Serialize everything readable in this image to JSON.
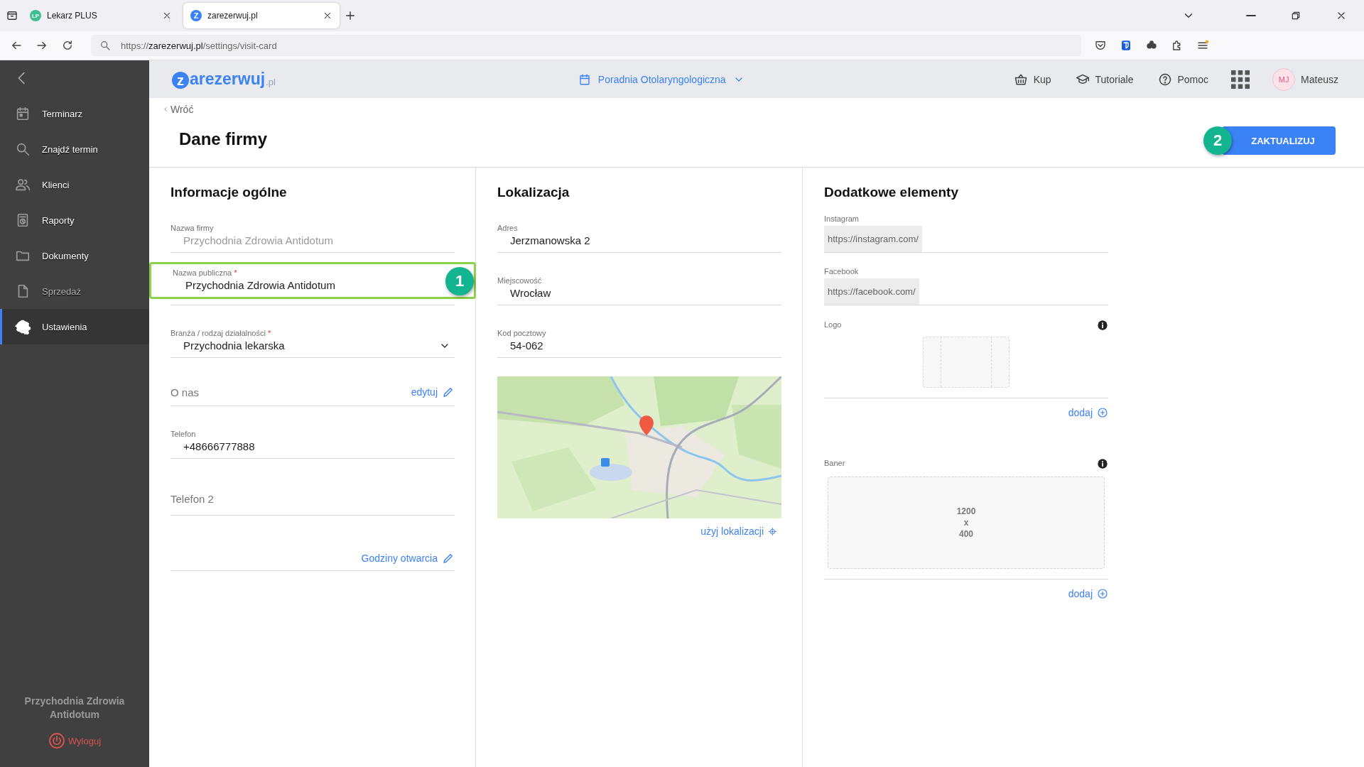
{
  "browser": {
    "tabs": [
      {
        "favicon": "LP",
        "title": "Lekarz PLUS",
        "selected": false
      },
      {
        "favicon": "Z",
        "title": "zarezerwuj.pl",
        "selected": true
      }
    ],
    "url": {
      "scheme": "https://",
      "host": "zarezerwuj.pl",
      "path": "/settings/visit-card"
    }
  },
  "sidebar": {
    "items": [
      {
        "label": "Terminarz",
        "selected": false,
        "disabled": false
      },
      {
        "label": "Znajdź termin",
        "selected": false,
        "disabled": false
      },
      {
        "label": "Klienci",
        "selected": false,
        "disabled": false
      },
      {
        "label": "Raporty",
        "selected": false,
        "disabled": false
      },
      {
        "label": "Dokumenty",
        "selected": false,
        "disabled": false
      },
      {
        "label": "Sprzedaż",
        "selected": false,
        "disabled": true
      },
      {
        "label": "Ustawienia",
        "selected": true,
        "disabled": false
      }
    ],
    "organization": "Przychodnia Zdrowia Antidotum",
    "logout": "Wyloguj"
  },
  "header": {
    "logo": {
      "mark": "z",
      "name": "arezerwuj",
      "suffix": ".pl"
    },
    "clinic": "Poradnia Otolaryngologiczna",
    "nav": [
      {
        "label": "Kup"
      },
      {
        "label": "Tutoriale"
      },
      {
        "label": "Pomoc"
      }
    ],
    "user": {
      "initials": "MJ",
      "name": "Mateusz"
    }
  },
  "page": {
    "back": "Wróć",
    "title": "Dane firmy",
    "action": {
      "label": "ZAKTUALIZUJ",
      "badge": "2"
    }
  },
  "sections": [
    {
      "title": "Informacje ogólne",
      "fields": [
        {
          "kind": "text",
          "label": "Nazwa firmy",
          "value": "Przychodnia Zdrowia Antidotum",
          "disabled": true
        },
        {
          "kind": "text",
          "label": "Nazwa publiczna",
          "required_mark": "*",
          "value": "Przychodnia Zdrowia Antidotum",
          "disabled": false,
          "highlighted": true,
          "badge": "1"
        },
        {
          "kind": "select",
          "label": "Branża / rodzaj działalności",
          "required_mark": "*",
          "value": "Przychodnia lekarska"
        },
        {
          "kind": "editable",
          "placeholder": "O nas",
          "link": "edytuj"
        },
        {
          "kind": "text",
          "label": "Telefon",
          "value": "+48666777888",
          "disabled": false
        },
        {
          "kind": "empty",
          "placeholder": "Telefon 2"
        },
        {
          "kind": "link",
          "link": "Godziny otwarcia"
        }
      ]
    },
    {
      "title": "Lokalizacja",
      "fields": [
        {
          "kind": "text",
          "label": "Adres",
          "value": "Jerzmanowska 2",
          "disabled": false
        },
        {
          "kind": "text",
          "label": "Miejscowość",
          "value": "Wrocław",
          "disabled": false
        },
        {
          "kind": "text",
          "label": "Kod pocztowy",
          "value": "54-062",
          "disabled": false
        },
        {
          "kind": "map",
          "link": "użyj lokalizacji"
        }
      ]
    },
    {
      "title": "Dodatkowe elementy",
      "fields": [
        {
          "kind": "prefixed",
          "label": "Instagram",
          "prefix": "https://instagram.com/"
        },
        {
          "kind": "prefixed",
          "label": "Facebook",
          "prefix": "https://facebook.com/"
        },
        {
          "kind": "logo-upload",
          "label": "Logo",
          "link": "dodaj"
        },
        {
          "kind": "banner-upload",
          "label": "Baner",
          "size": [
            "1200",
            "x",
            "400"
          ],
          "link": "dodaj"
        }
      ]
    }
  ]
}
